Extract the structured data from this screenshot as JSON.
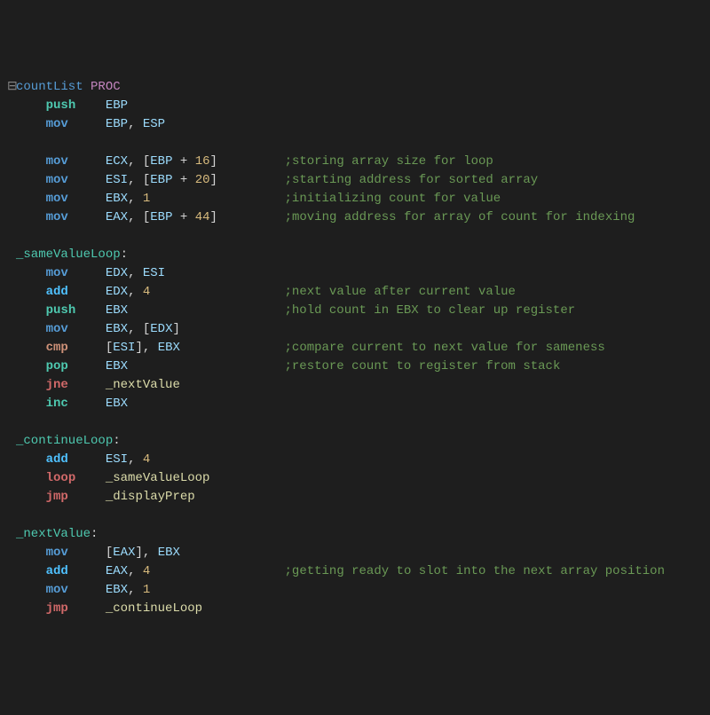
{
  "fold": "⊟",
  "lines": [
    {
      "indent": 0,
      "fold": true,
      "parts": [
        {
          "c": "proc-name",
          "t": "countList"
        },
        {
          "c": "",
          "t": " "
        },
        {
          "c": "kw-proc",
          "t": "PROC"
        }
      ]
    },
    {
      "indent": 1,
      "parts": [
        {
          "c": "kw-push",
          "t": "push"
        },
        {
          "c": "",
          "t": "    "
        },
        {
          "c": "reg",
          "t": "EBP"
        }
      ]
    },
    {
      "indent": 1,
      "parts": [
        {
          "c": "kw-mov",
          "t": "mov"
        },
        {
          "c": "",
          "t": "     "
        },
        {
          "c": "reg",
          "t": "EBP"
        },
        {
          "c": "punct",
          "t": ", "
        },
        {
          "c": "reg",
          "t": "ESP"
        }
      ]
    },
    {
      "indent": 0,
      "parts": []
    },
    {
      "indent": 1,
      "parts": [
        {
          "c": "kw-mov",
          "t": "mov"
        },
        {
          "c": "",
          "t": "     "
        },
        {
          "c": "reg",
          "t": "ECX"
        },
        {
          "c": "punct",
          "t": ", ["
        },
        {
          "c": "reg",
          "t": "EBP"
        },
        {
          "c": "punct",
          "t": " + "
        },
        {
          "c": "num",
          "t": "16"
        },
        {
          "c": "punct",
          "t": "]"
        },
        {
          "c": "",
          "t": "         "
        },
        {
          "c": "comment",
          "t": ";storing array size for loop"
        }
      ]
    },
    {
      "indent": 1,
      "parts": [
        {
          "c": "kw-mov",
          "t": "mov"
        },
        {
          "c": "",
          "t": "     "
        },
        {
          "c": "reg",
          "t": "ESI"
        },
        {
          "c": "punct",
          "t": ", ["
        },
        {
          "c": "reg",
          "t": "EBP"
        },
        {
          "c": "punct",
          "t": " + "
        },
        {
          "c": "num",
          "t": "20"
        },
        {
          "c": "punct",
          "t": "]"
        },
        {
          "c": "",
          "t": "         "
        },
        {
          "c": "comment",
          "t": ";starting address for sorted array"
        }
      ]
    },
    {
      "indent": 1,
      "parts": [
        {
          "c": "kw-mov",
          "t": "mov"
        },
        {
          "c": "",
          "t": "     "
        },
        {
          "c": "reg",
          "t": "EBX"
        },
        {
          "c": "punct",
          "t": ", "
        },
        {
          "c": "num",
          "t": "1"
        },
        {
          "c": "",
          "t": "                  "
        },
        {
          "c": "comment",
          "t": ";initializing count for value"
        }
      ]
    },
    {
      "indent": 1,
      "parts": [
        {
          "c": "kw-mov",
          "t": "mov"
        },
        {
          "c": "",
          "t": "     "
        },
        {
          "c": "reg",
          "t": "EAX"
        },
        {
          "c": "punct",
          "t": ", ["
        },
        {
          "c": "reg",
          "t": "EBP"
        },
        {
          "c": "punct",
          "t": " + "
        },
        {
          "c": "num",
          "t": "44"
        },
        {
          "c": "punct",
          "t": "]"
        },
        {
          "c": "",
          "t": "         "
        },
        {
          "c": "comment",
          "t": ";moving address for array of count for indexing"
        }
      ]
    },
    {
      "indent": 0,
      "parts": []
    },
    {
      "indent": 0,
      "parts": [
        {
          "c": "labeldef",
          "t": "_sameValueLoop"
        },
        {
          "c": "punct",
          "t": ":"
        }
      ]
    },
    {
      "indent": 1,
      "parts": [
        {
          "c": "kw-mov",
          "t": "mov"
        },
        {
          "c": "",
          "t": "     "
        },
        {
          "c": "reg",
          "t": "EDX"
        },
        {
          "c": "punct",
          "t": ", "
        },
        {
          "c": "reg",
          "t": "ESI"
        }
      ]
    },
    {
      "indent": 1,
      "parts": [
        {
          "c": "kw-add",
          "t": "add"
        },
        {
          "c": "",
          "t": "     "
        },
        {
          "c": "reg",
          "t": "EDX"
        },
        {
          "c": "punct",
          "t": ", "
        },
        {
          "c": "num",
          "t": "4"
        },
        {
          "c": "",
          "t": "                  "
        },
        {
          "c": "comment",
          "t": ";next value after current value"
        }
      ]
    },
    {
      "indent": 1,
      "parts": [
        {
          "c": "kw-push",
          "t": "push"
        },
        {
          "c": "",
          "t": "    "
        },
        {
          "c": "reg",
          "t": "EBX"
        },
        {
          "c": "",
          "t": "                     "
        },
        {
          "c": "comment",
          "t": ";hold count in EBX to clear up register"
        }
      ]
    },
    {
      "indent": 1,
      "parts": [
        {
          "c": "kw-mov",
          "t": "mov"
        },
        {
          "c": "",
          "t": "     "
        },
        {
          "c": "reg",
          "t": "EBX"
        },
        {
          "c": "punct",
          "t": ", ["
        },
        {
          "c": "reg",
          "t": "EDX"
        },
        {
          "c": "punct",
          "t": "]"
        }
      ]
    },
    {
      "indent": 1,
      "parts": [
        {
          "c": "kw-cmp",
          "t": "cmp"
        },
        {
          "c": "",
          "t": "     "
        },
        {
          "c": "punct",
          "t": "["
        },
        {
          "c": "reg",
          "t": "ESI"
        },
        {
          "c": "punct",
          "t": "], "
        },
        {
          "c": "reg",
          "t": "EBX"
        },
        {
          "c": "",
          "t": "              "
        },
        {
          "c": "comment",
          "t": ";compare current to next value for sameness"
        }
      ]
    },
    {
      "indent": 1,
      "parts": [
        {
          "c": "kw-pop",
          "t": "pop"
        },
        {
          "c": "",
          "t": "     "
        },
        {
          "c": "reg",
          "t": "EBX"
        },
        {
          "c": "",
          "t": "                     "
        },
        {
          "c": "comment",
          "t": ";restore count to register from stack"
        }
      ]
    },
    {
      "indent": 1,
      "parts": [
        {
          "c": "kw-jne",
          "t": "jne"
        },
        {
          "c": "",
          "t": "     "
        },
        {
          "c": "label",
          "t": "_nextValue"
        }
      ]
    },
    {
      "indent": 1,
      "parts": [
        {
          "c": "kw-inc",
          "t": "inc"
        },
        {
          "c": "",
          "t": "     "
        },
        {
          "c": "reg",
          "t": "EBX"
        }
      ]
    },
    {
      "indent": 0,
      "parts": []
    },
    {
      "indent": 0,
      "parts": [
        {
          "c": "labeldef",
          "t": "_continueLoop"
        },
        {
          "c": "punct",
          "t": ":"
        }
      ]
    },
    {
      "indent": 1,
      "parts": [
        {
          "c": "kw-add",
          "t": "add"
        },
        {
          "c": "",
          "t": "     "
        },
        {
          "c": "reg",
          "t": "ESI"
        },
        {
          "c": "punct",
          "t": ", "
        },
        {
          "c": "num",
          "t": "4"
        }
      ]
    },
    {
      "indent": 1,
      "parts": [
        {
          "c": "kw-loop",
          "t": "loop"
        },
        {
          "c": "",
          "t": "    "
        },
        {
          "c": "label",
          "t": "_sameValueLoop"
        }
      ]
    },
    {
      "indent": 1,
      "parts": [
        {
          "c": "kw-jmp",
          "t": "jmp"
        },
        {
          "c": "",
          "t": "     "
        },
        {
          "c": "label",
          "t": "_displayPrep"
        }
      ]
    },
    {
      "indent": 0,
      "parts": []
    },
    {
      "indent": 0,
      "parts": [
        {
          "c": "labeldef",
          "t": "_nextValue"
        },
        {
          "c": "punct",
          "t": ":"
        }
      ]
    },
    {
      "indent": 1,
      "parts": [
        {
          "c": "kw-mov",
          "t": "mov"
        },
        {
          "c": "",
          "t": "     "
        },
        {
          "c": "punct",
          "t": "["
        },
        {
          "c": "reg",
          "t": "EAX"
        },
        {
          "c": "punct",
          "t": "], "
        },
        {
          "c": "reg",
          "t": "EBX"
        }
      ]
    },
    {
      "indent": 1,
      "parts": [
        {
          "c": "kw-add",
          "t": "add"
        },
        {
          "c": "",
          "t": "     "
        },
        {
          "c": "reg",
          "t": "EAX"
        },
        {
          "c": "punct",
          "t": ", "
        },
        {
          "c": "num",
          "t": "4"
        },
        {
          "c": "",
          "t": "                  "
        },
        {
          "c": "comment",
          "t": ";getting ready to slot into the next array position"
        }
      ]
    },
    {
      "indent": 1,
      "parts": [
        {
          "c": "kw-mov",
          "t": "mov"
        },
        {
          "c": "",
          "t": "     "
        },
        {
          "c": "reg",
          "t": "EBX"
        },
        {
          "c": "punct",
          "t": ", "
        },
        {
          "c": "num",
          "t": "1"
        }
      ]
    },
    {
      "indent": 1,
      "parts": [
        {
          "c": "kw-jmp",
          "t": "jmp"
        },
        {
          "c": "",
          "t": "     "
        },
        {
          "c": "label",
          "t": "_continueLoop"
        }
      ]
    }
  ]
}
